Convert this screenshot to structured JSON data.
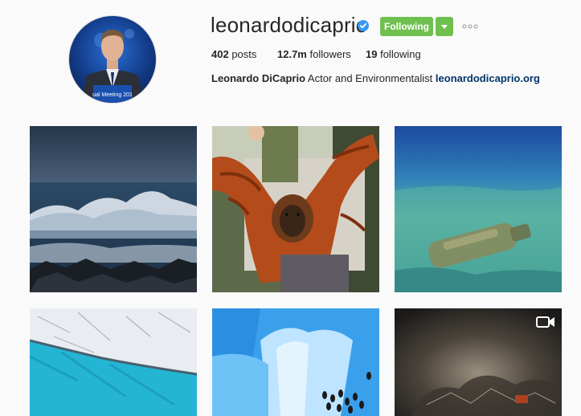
{
  "profile": {
    "username": "leonardodicaprio",
    "follow_label": "Following",
    "stats": {
      "posts_count": "402",
      "posts_label": "posts",
      "followers_count": "12.7m",
      "followers_label": "followers",
      "following_count": "19",
      "following_label": "following"
    },
    "bio": {
      "full_name": "Leonardo DiCaprio",
      "description": "Actor and Environmentalist",
      "link": "leonardodicaprio.org"
    },
    "avatar_caption": "ual Meeting 201"
  },
  "colors": {
    "follow_green": "#70c050",
    "verified_blue": "#3897f0",
    "link_blue": "#003569"
  },
  "icons": {
    "verified": "verified-badge-icon",
    "dropdown": "chevron-down-icon",
    "more": "more-options-icon",
    "video": "video-camera-icon"
  },
  "posts": [
    {
      "subject": "ocean-wave"
    },
    {
      "subject": "orangutan"
    },
    {
      "subject": "underwater-bottle"
    },
    {
      "subject": "glacier-ice"
    },
    {
      "subject": "blue-ice-penguins"
    },
    {
      "subject": "smoke-video",
      "is_video": true
    }
  ]
}
